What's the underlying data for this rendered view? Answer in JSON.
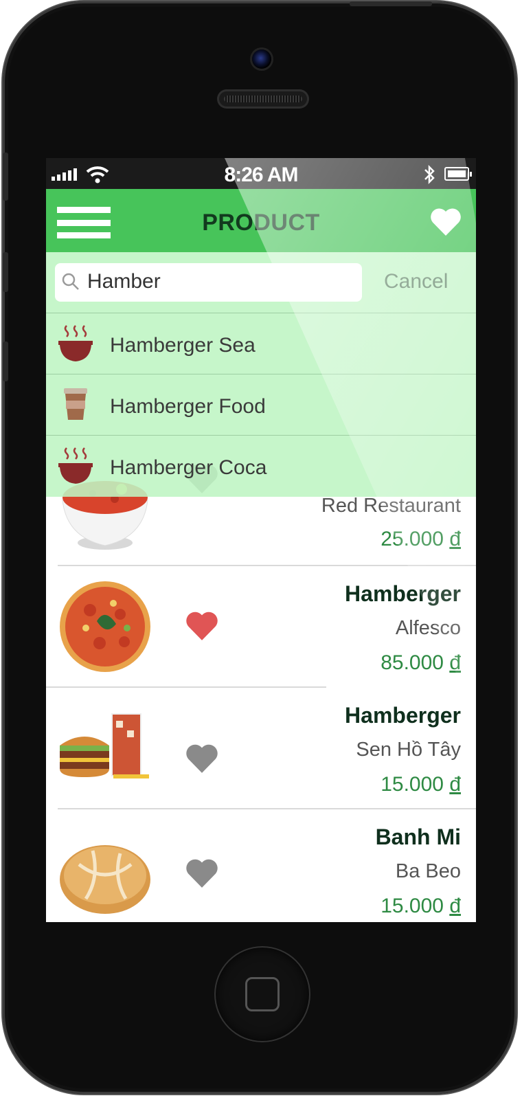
{
  "status_bar": {
    "time": "8:26 AM"
  },
  "header": {
    "title": "PRODUCT"
  },
  "search": {
    "value": "Hamber",
    "cancel_label": "Cancel"
  },
  "suggestions": [
    {
      "label": "Hamberger Sea",
      "icon": "soup-bowl-icon"
    },
    {
      "label": "Hamberger Food",
      "icon": "coffee-cup-icon"
    },
    {
      "label": "Hamberger Coca",
      "icon": "soup-bowl-icon"
    }
  ],
  "products": [
    {
      "name": "",
      "shop": "Red Restaurant",
      "price": "25.000",
      "currency": "đ",
      "favorite": false,
      "image": "soup-bowl"
    },
    {
      "name": "Hamberger",
      "shop": "Alfesco",
      "price": "85.000",
      "currency": "đ",
      "favorite": true,
      "image": "pizza"
    },
    {
      "name": "Hamberger",
      "shop": "Sen Hồ Tây",
      "price": "15.000",
      "currency": "đ",
      "favorite": false,
      "image": "burger-combo"
    },
    {
      "name": "Banh Mi",
      "shop": "Ba Beo",
      "price": "15.000",
      "currency": "đ",
      "favorite": false,
      "image": "bread-roll"
    }
  ],
  "colors": {
    "primary": "#47c45a",
    "price": "#2e8a43",
    "heart_active": "#e05555",
    "heart_inactive": "#8a8a8a"
  }
}
